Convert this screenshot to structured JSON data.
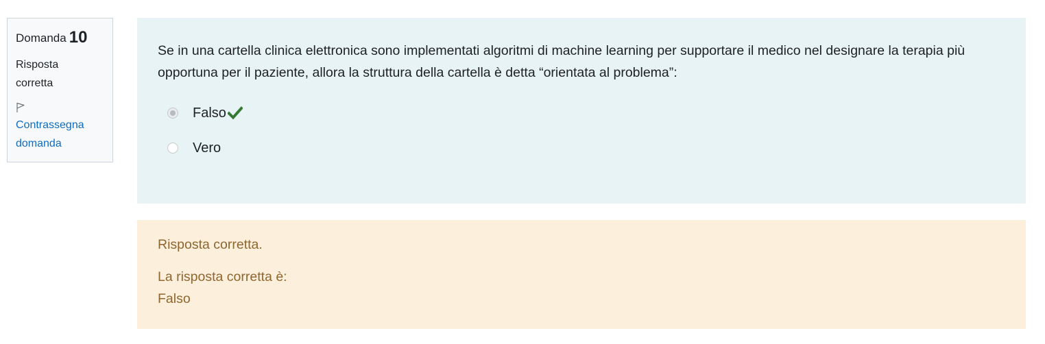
{
  "info": {
    "question_label": "Domanda",
    "question_number": "10",
    "state": "Risposta corretta",
    "flag_label": "Contrassegna domanda"
  },
  "question": {
    "text": "Se in una cartella clinica elettronica sono implementati algoritmi di machine learning per supportare il medico nel designare la terapia più opportuna per il paziente, allora la struttura della cartella è detta “orientata al problema”:",
    "options": [
      {
        "label": "Falso",
        "selected": true,
        "correct": true
      },
      {
        "label": "Vero",
        "selected": false,
        "correct": false
      }
    ]
  },
  "outcome": {
    "feedback": "Risposta corretta.",
    "right_answer_label": "La risposta corretta è:",
    "right_answer_value": "Falso"
  },
  "colors": {
    "question_bg": "#e7f3f5",
    "outcome_bg": "#fcefdc",
    "outcome_text": "#8e662e",
    "link": "#0f6cbf",
    "check": "#357a32"
  },
  "icons": {
    "flag": "flag-icon",
    "correct": "check-icon"
  }
}
